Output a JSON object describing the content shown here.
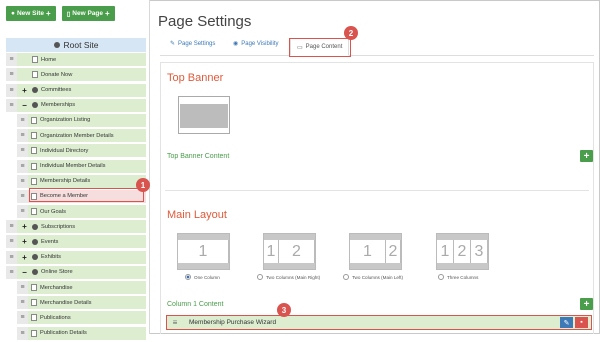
{
  "toolbar": {
    "new_site": "New Site",
    "new_page": "New Page"
  },
  "tree": {
    "root": "Root Site",
    "items": [
      {
        "label": "Home",
        "toggle": "",
        "icon": "file"
      },
      {
        "label": "Donate Now",
        "toggle": "",
        "icon": "file"
      },
      {
        "label": "Committees",
        "toggle": "+",
        "icon": "globe"
      },
      {
        "label": "Memberships",
        "toggle": "−",
        "icon": "globe"
      },
      {
        "label": "Organization Listing",
        "toggle": "",
        "icon": "file"
      },
      {
        "label": "Organization Member Details",
        "toggle": "",
        "icon": "file"
      },
      {
        "label": "Individual Directory",
        "toggle": "",
        "icon": "file"
      },
      {
        "label": "Individual Member Details",
        "toggle": "",
        "icon": "file"
      },
      {
        "label": "Membership Details",
        "toggle": "",
        "icon": "file"
      },
      {
        "label": "Become a Member",
        "toggle": "",
        "icon": "file"
      },
      {
        "label": "Our Goals",
        "toggle": "",
        "icon": "file"
      },
      {
        "label": "Subscriptions",
        "toggle": "+",
        "icon": "globe"
      },
      {
        "label": "Events",
        "toggle": "+",
        "icon": "globe"
      },
      {
        "label": "Exhibits",
        "toggle": "+",
        "icon": "globe"
      },
      {
        "label": "Online Store",
        "toggle": "−",
        "icon": "globe"
      },
      {
        "label": "Merchandise",
        "toggle": "",
        "icon": "file"
      },
      {
        "label": "Merchandise Details",
        "toggle": "",
        "icon": "file"
      },
      {
        "label": "Publications",
        "toggle": "",
        "icon": "file"
      },
      {
        "label": "Publication Details",
        "toggle": "",
        "icon": "file"
      }
    ]
  },
  "page": {
    "title": "Page Settings",
    "tabs": {
      "settings": "Page Settings",
      "visibility": "Page Visibility",
      "content": "Page Content"
    }
  },
  "banner": {
    "title": "Top Banner",
    "content_label": "Top Banner Content"
  },
  "layout": {
    "title": "Main Layout",
    "options": {
      "one": "One Column",
      "two_right": "Two Columns (Main Right)",
      "two_left": "Two Columns (Main Left)",
      "three": "Three Columns"
    },
    "nums": {
      "n1": "1",
      "n2": "2",
      "n3": "3"
    },
    "selected": "One Column"
  },
  "column1": {
    "label": "Column 1 Content",
    "widget": "Membership Purchase Wizard"
  },
  "badges": {
    "b1": "1",
    "b2": "2",
    "b3": "3"
  },
  "colors": {
    "green": "#4a9d4a",
    "accent_red": "#d9534f",
    "title_orange": "#e05a3a",
    "link_blue": "#3d79b7"
  }
}
